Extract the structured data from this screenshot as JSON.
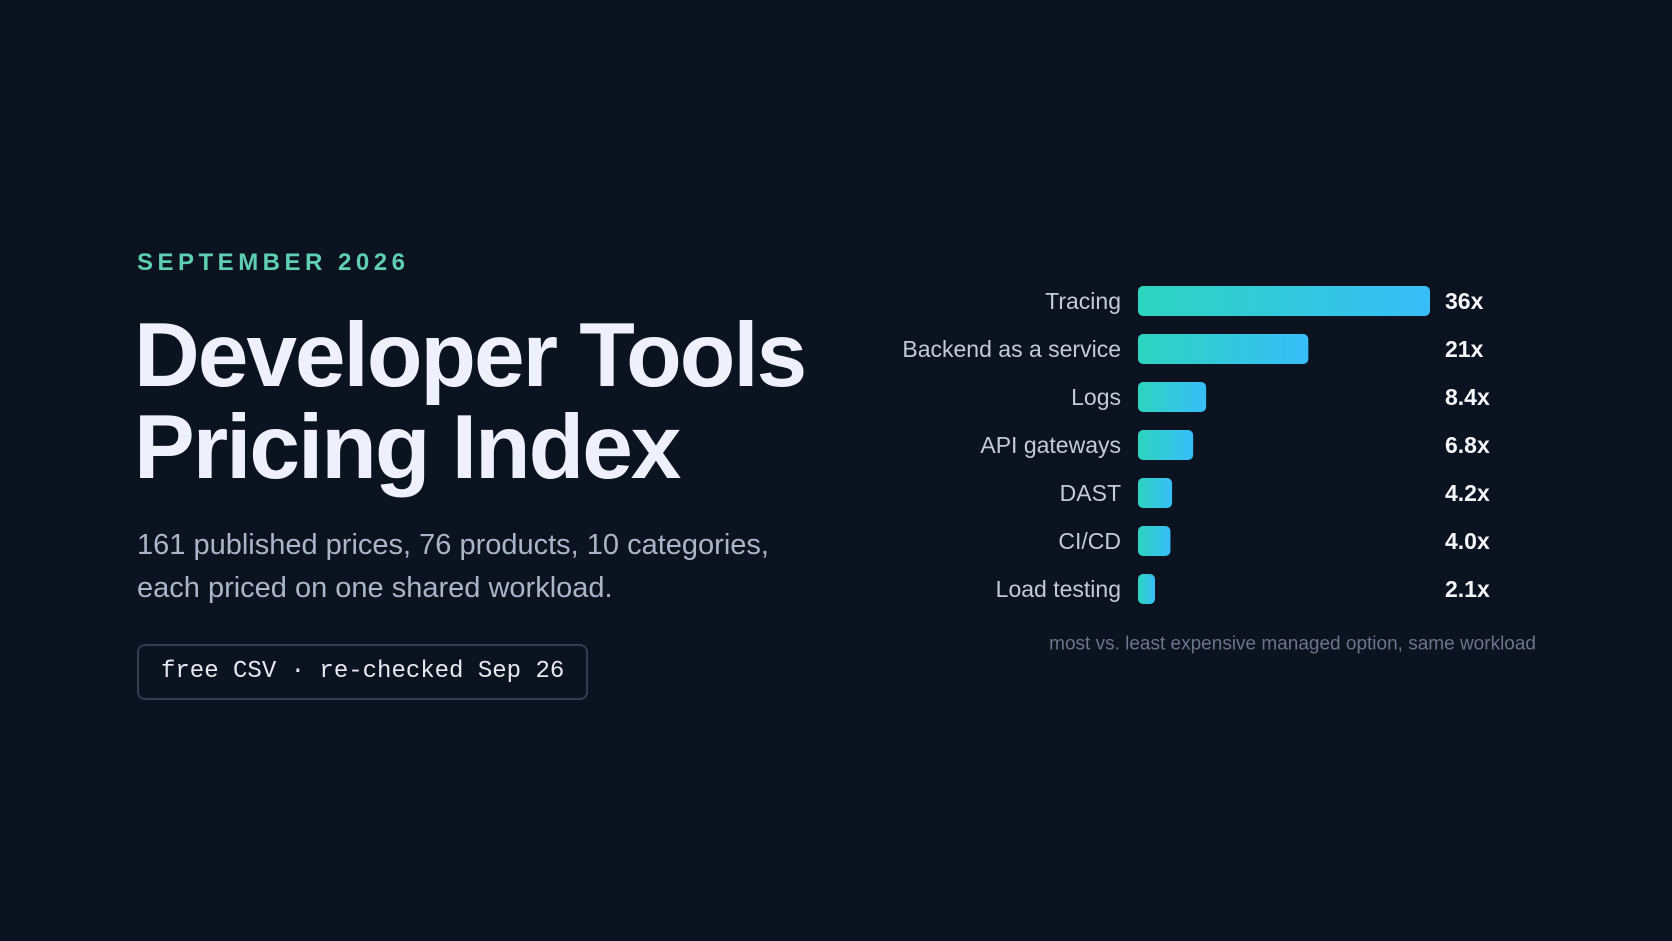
{
  "eyebrow": "SEPTEMBER 2026",
  "title_lines": [
    "Developer Tools",
    "Pricing Index"
  ],
  "subtitle_lines": [
    "161 published prices, 76 products, 10 categories,",
    "each priced on one shared workload."
  ],
  "badge": "free CSV · re-checked Sep 26",
  "colors": {
    "background": "#0b1220",
    "eyebrow": "#5ecfb1",
    "title": "#eef1fb",
    "subtitle": "#aab5c8",
    "bar_gradient_start": "#2dd4bf",
    "bar_gradient_end": "#38bdf8",
    "category_label": "#c3cad8",
    "value_label": "#f4f6fb",
    "note": "#6b7589"
  },
  "chart_data": {
    "type": "bar",
    "orientation": "horizontal",
    "categories": [
      "Tracing",
      "Backend as a service",
      "Logs",
      "API gateways",
      "DAST",
      "CI/CD",
      "Load testing"
    ],
    "values": [
      36,
      21,
      8.4,
      6.8,
      4.2,
      4.0,
      2.1
    ],
    "value_labels": [
      "36x",
      "21x",
      "8.4x",
      "6.8x",
      "4.2x",
      "4.0x",
      "2.1x"
    ],
    "note": "most vs. least expensive managed option, same workload",
    "xlim": [
      0,
      36
    ],
    "grid": false,
    "legend": "none"
  }
}
